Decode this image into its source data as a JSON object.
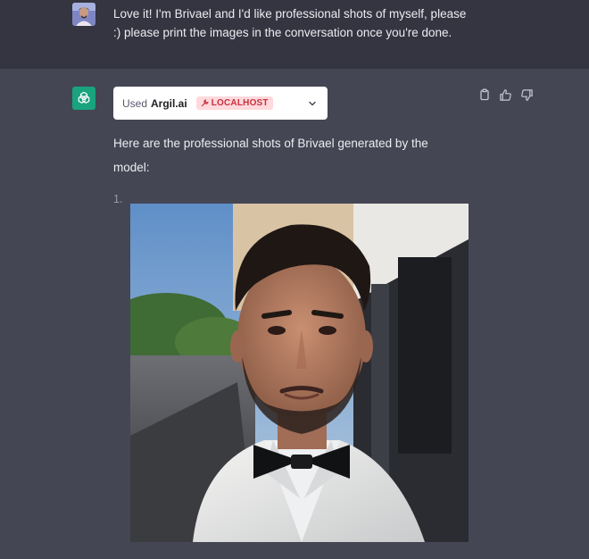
{
  "user_message": {
    "line1": "Love it! I'm Brivael and I'd like professional shots of myself, please",
    "line2": ":) please print the images in the conversation once you're done."
  },
  "plugin": {
    "used_label": "Used",
    "name": "Argil.ai",
    "badge": "LOCALHOST"
  },
  "assistant": {
    "line1": "Here are the professional shots of Brivael generated by the",
    "line2": "model:",
    "list_number": "1."
  },
  "icons": {
    "user_avatar": "user-avatar-image",
    "gpt_logo": "openai-logo-icon",
    "copy": "clipboard-icon",
    "thumbs_up": "thumbs-up-icon",
    "thumbs_down": "thumbs-down-icon",
    "chevron": "chevron-down-icon",
    "badge": "wrench-icon"
  },
  "colors": {
    "user_bg": "#343541",
    "assistant_bg": "#444654",
    "gpt_green": "#19a37f",
    "badge_bg": "#ffd9dc",
    "badge_text": "#c9303e"
  }
}
